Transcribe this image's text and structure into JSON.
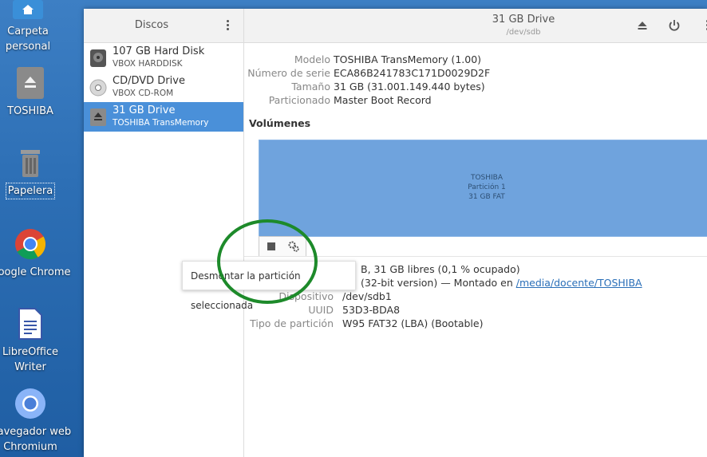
{
  "desktop": {
    "icons": [
      {
        "label": "Carpeta personal",
        "icon": "home-icon"
      },
      {
        "label": "TOSHIBA",
        "icon": "eject-drive-icon"
      },
      {
        "label": "Papelera",
        "icon": "trash-icon"
      },
      {
        "label": "Google Chrome",
        "icon": "chrome-icon"
      },
      {
        "label": "LibreOffice Writer",
        "icon": "writer-icon"
      },
      {
        "label": "Navegador web Chromium",
        "icon": "chromium-icon"
      }
    ]
  },
  "sidebar": {
    "title": "Discos",
    "drives": [
      {
        "name": "107 GB Hard Disk",
        "sub": "VBOX HARDDISK",
        "icon": "hard-disk-icon"
      },
      {
        "name": "CD/DVD Drive",
        "sub": "VBOX CD-ROM",
        "icon": "optical-drive-icon"
      },
      {
        "name": "31 GB Drive",
        "sub": "TOSHIBA TransMemory",
        "icon": "usb-drive-icon"
      }
    ]
  },
  "drive": {
    "title": "31 GB Drive",
    "device": "/dev/sdb",
    "model_label": "Modelo",
    "model": "TOSHIBA TransMemory (1.00)",
    "serial_label": "Número de serie",
    "serial": "ECA86B241783C171D0029D2F",
    "size_label": "Tamaño",
    "size": "31 GB (31.001.149.440 bytes)",
    "partitioning_label": "Particionado",
    "partitioning": "Master Boot Record"
  },
  "volumes": {
    "heading": "Volúmenes",
    "partition_name": "TOSHIBA",
    "partition_num": "Partición 1",
    "partition_fs": "31 GB FAT",
    "size_value_tail": "B, 31 GB libres (0,1 % ocupado)",
    "content_value_tail": "(32-bit version) — Montado en",
    "mount_link": "/media/docente/TOSHIBA",
    "device_label": "Dispositivo",
    "device": "/dev/sdb1",
    "uuid_label": "UUID",
    "uuid": "53D3-BDA8",
    "ptype_label": "Tipo de partición",
    "ptype": "W95 FAT32 (LBA) (Bootable)"
  },
  "tooltip": "Desmontar la partición seleccionada",
  "colors": {
    "selection": "#4a90d9",
    "partition": "#6fa3dd",
    "highlight_circle": "#1d8a2a"
  }
}
